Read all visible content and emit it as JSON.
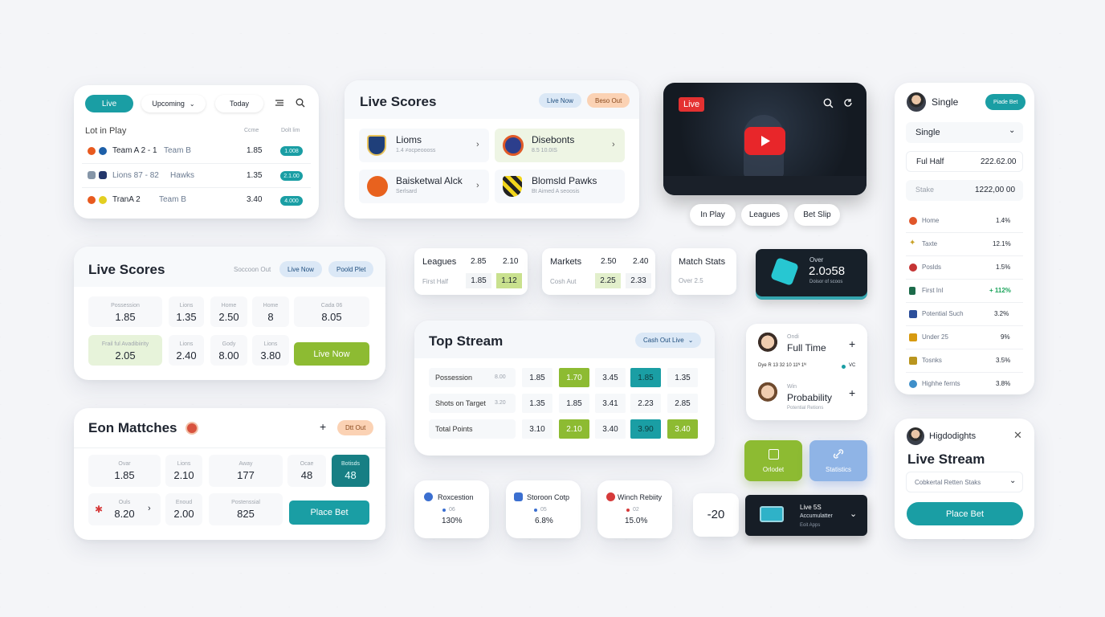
{
  "c1": {
    "tabs": [
      "Live",
      "Upcoming",
      "Today"
    ],
    "section_title": "Lot in Play",
    "col1": "Ccme",
    "col2": "Dolt lim",
    "rows": [
      {
        "team_a": "Team A 2 - 1",
        "team_b": "Team B",
        "odds": "1.85",
        "badge": "1.008"
      },
      {
        "team_a": "Lions 87 - 82",
        "team_b": "Hawks",
        "odds": "1.35",
        "badge": "2.1.00"
      },
      {
        "team_a": "TranA 2",
        "team_b": "Team B",
        "odds": "3.40",
        "badge": "4.000"
      }
    ]
  },
  "c2": {
    "title": "Live Scores",
    "pill1": "Live Now",
    "pill2": "Beso Out",
    "items": [
      {
        "name": "Lioms",
        "sub": "1.4 ≠ocpeoooss"
      },
      {
        "name": "Disebonts",
        "sub": "8.5 10.0IS"
      },
      {
        "name": "Baisketwal Alck",
        "sub": "Serlsard"
      },
      {
        "name": "Blomsld Pawks",
        "sub": "Bt Aimed A seoosis"
      }
    ]
  },
  "c3": {
    "live_label": "Live",
    "chips": [
      "In Play",
      "Leagues",
      "Bet Slip"
    ]
  },
  "c4": {
    "title": "Single",
    "pill": "Piade Bet",
    "select": "Single",
    "row1_label": "Ful Half",
    "row1_value": "222.62.00",
    "row2_label": "Stake",
    "row2_value": "1222,00 00",
    "list": [
      {
        "label": "Home",
        "value": "1.4%"
      },
      {
        "label": "Taxte",
        "value": "12.1%"
      },
      {
        "label": "Poslds",
        "value": "1.5%"
      },
      {
        "label": "First Inl",
        "value": "+ 112%"
      },
      {
        "label": "Potential Such",
        "value": "3.2%"
      },
      {
        "label": "Under 25",
        "value": "9%"
      },
      {
        "label": "Tosnks",
        "value": "3.5%"
      },
      {
        "label": "Highhe fernts",
        "value": "3.8%"
      }
    ]
  },
  "c5": {
    "title": "Live Scores",
    "small": "Soccoon Out",
    "pill1": "Live Now",
    "pill2": "Poold Plet",
    "tiles": [
      {
        "label": "Possession",
        "value": "1.85"
      },
      {
        "label": "Lions",
        "value": "1.35"
      },
      {
        "label": "Home",
        "value": "2.50"
      },
      {
        "label": "Home",
        "value": "8"
      },
      {
        "label": "Cada 06",
        "value": "8.05"
      },
      {
        "label": "Frail ful Avadibiirity",
        "value": "2.05"
      },
      {
        "label": "Lions",
        "value": "2.40"
      },
      {
        "label": "Gody",
        "value": "8.00"
      },
      {
        "label": "Lions",
        "value": "3.80"
      }
    ],
    "button": "Live Now"
  },
  "c6": {
    "title": "Eon Mattches",
    "pill": "Dtt Out",
    "plus": "+",
    "tiles": [
      {
        "label": "Ovar",
        "value": "1.85"
      },
      {
        "label": "Lions",
        "value": "2.10"
      },
      {
        "label": "Away",
        "value": "177"
      },
      {
        "label": "Ocae",
        "value": "48"
      },
      {
        "label": "Botisds",
        "value": "48"
      },
      {
        "label": "Ouls",
        "value": "8.20"
      },
      {
        "label": "Enoud",
        "value": "2.00"
      },
      {
        "label": "Postenssial",
        "value": "825"
      }
    ],
    "button": "Place Bet"
  },
  "c7": [
    {
      "title": "Leagues",
      "a": "2.85",
      "b": "2.10",
      "sub": "First Half",
      "c": "1.85",
      "d": "1.12"
    },
    {
      "title": "Markets",
      "a": "2.50",
      "b": "2.40",
      "sub": "Cosh Aut",
      "c": "2.25",
      "d": "2.33"
    },
    {
      "title": "Match Stats",
      "sub": "Over 2.5"
    }
  ],
  "c8": {
    "top": "Over",
    "value": "2.0ɔ58",
    "sub": "Doisor of scoos"
  },
  "c9": {
    "title": "Top Stream",
    "pill": "Cash Out Live",
    "rows": [
      {
        "label": "Possession",
        "meta": "8.00",
        "vals": [
          "1.85",
          "1.70",
          "3.45",
          "1.85",
          "1.35"
        ]
      },
      {
        "label": "Shots on Target",
        "meta": "3.20",
        "vals": [
          "1.35",
          "1.85",
          "3.41",
          "2.23",
          "2.85"
        ]
      },
      {
        "label": "Total Points",
        "meta": "",
        "vals": [
          "3.10",
          "2.10",
          "3.40",
          "3.90",
          "3.40"
        ]
      }
    ]
  },
  "c10": {
    "p1_top": "Ondi",
    "p1_title": "Full Time",
    "p1_plus": "+",
    "mid_left": "Dye R  13 32 10  11ᴺ 1ᴺ",
    "mid_right": "VC",
    "p2_top": "Win",
    "p2_title": "Probability",
    "p2_sub": "Potential Retions",
    "p2_plus": "+"
  },
  "c11": {
    "t1": "Orlodet",
    "t2": "Statistics"
  },
  "c12": [
    {
      "title": "Roxcestion",
      "sub": "06",
      "value": "130%"
    },
    {
      "title": "Storoon Cotp",
      "sub": "05",
      "value": "6.8%"
    },
    {
      "title": "Winch Rebiity",
      "sub": "02",
      "value": "15.0%"
    }
  ],
  "c13": {
    "value": "-20",
    "dark_title": "Live 5S",
    "dark_sub": "Accumulatter",
    "dark_sub2": "Eoit Apps"
  },
  "c14": {
    "title": "Higdodights",
    "heading": "Live Stream",
    "select": "Cobkertal Retten Staks",
    "button": "Place Bet"
  },
  "colors": {
    "teal": "#1a9ea4",
    "green": "#8dbb32",
    "orange": "#f6b48a",
    "dark": "#1c2330"
  }
}
